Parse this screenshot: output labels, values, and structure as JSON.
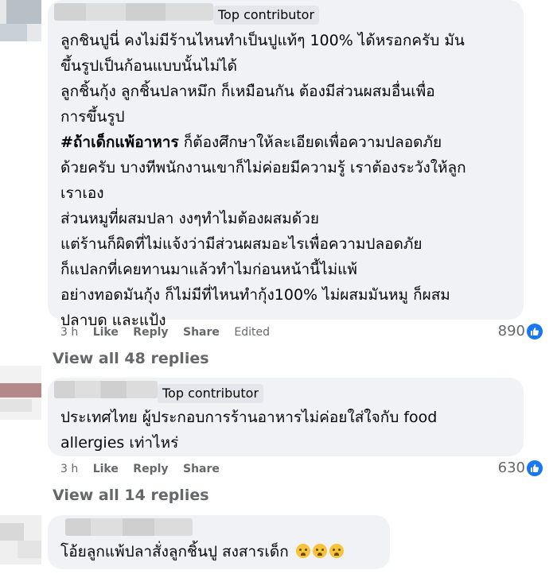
{
  "colors": {
    "bubble": "#f0f2f5",
    "badge": "#e4e6eb",
    "like_blue": "#1877f2",
    "meta_gray": "#65676b"
  },
  "comments": [
    {
      "badge": "Top contributor",
      "lines": [
        "ลูกชินปูนี่ คงไม่มีร้านไหนทำเป็นปูแท้ๆ 100% ได้หรอกครับ มัน",
        "ขึ้นรูปเป็นก้อนแบบนั้นไม่ได้",
        "ลูกชิ้นกุ้ง ลูกชิ้นปลาหมึก ก็เหมือนกัน ต้องมีส่วนผสมอื่นเพื่อ",
        "การขึ้นรูป"
      ],
      "hashtag": "#ถ้าเด็กแพ้อาหาร",
      "hashtag_rest": " ก็ต้องศึกษาให้ละเอียดเพื่อความปลอดภัย",
      "lines_after": [
        "ด้วยครับ บางทีพนักงานเขาก็ไม่ค่อยมีความรู้ เราต้องระวังให้ลูก",
        "เราเอง",
        "ส่วนหมูที่ผสมปลา งงๆทำไมต้องผสมด้วย",
        "แต่ร้านก็ผิดที่ไม่แจ้งว่ามีส่วนผสมอะไรเพื่อความปลอดภัย",
        "ก็แปลกที่เคยทานมาแล้วทำไมก่อนหน้านี้ไม่แพ้",
        "อย่างทอดมันกุ้ง ก็ไม่มีที่ไหนทำกุ้ง100% ไม่ผสมมันหมู ก็ผสม",
        "ปลาบด และแป้ง"
      ],
      "time": "3 h",
      "like": "Like",
      "reply": "Reply",
      "share": "Share",
      "edited": "Edited",
      "reactions": "890",
      "view_replies": "View all 48 replies"
    },
    {
      "badge": "Top contributor",
      "lines": [
        "ประเทศไทย ผู้ประกอบการร้านอาหารไม่ค่อยใส่ใจกับ food",
        "allergies เท่าไหร่"
      ],
      "time": "3 h",
      "like": "Like",
      "reply": "Reply",
      "share": "Share",
      "reactions": "630",
      "view_replies": "View all 14 replies"
    },
    {
      "lines": [
        "โอ้ยลูกแพ้ปลาสั่งลูกชิ้นปู สงสารเด็ก"
      ],
      "emoji_icons": [
        "crying-face-icon",
        "crying-face-icon",
        "crying-face-icon"
      ]
    }
  ]
}
